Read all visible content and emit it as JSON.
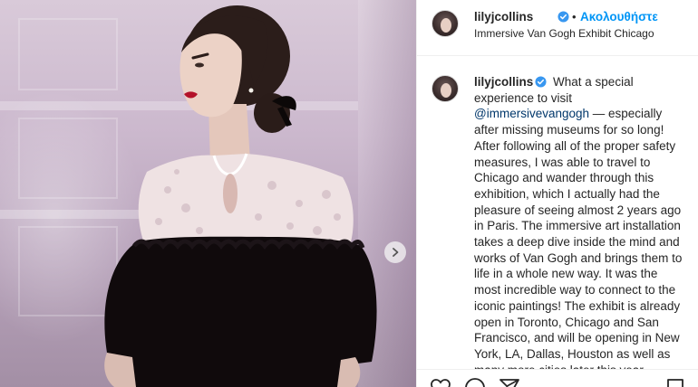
{
  "post": {
    "username": "lilyjcollins",
    "follow_separator": "•",
    "follow_label": "Ακολουθήστε",
    "location": "Immersive Van Gogh Exhibit Chicago",
    "caption_user": "lilyjcollins",
    "caption_text_1": " What a special experience to visit ",
    "caption_mention": "@immersivevangogh",
    "caption_text_2": " — especially after missing museums for so long! After following all of the proper safety measures, I was able to travel to Chicago and wander through this exhibition, which I actually had the pleasure of seeing almost 2 years ago in Paris. The immersive art installation takes a deep dive inside the mind and works of Van Gogh and brings them to life in a whole new way. It was the most incredible way to connect to the iconic paintings! The exhibit is already open in Toronto, Chicago and San Francisco, and will be opening in New York, LA, Dallas, Houston as well as many more cities later this year -"
  },
  "colors": {
    "link_blue": "#0095f6",
    "mention_blue": "#00376b",
    "verified_blue": "#3897f0",
    "text": "#262626",
    "border": "#efefef"
  },
  "icons": {
    "verified": "verified-badge-icon",
    "next": "chevron-right-icon",
    "like": "heart-icon",
    "comment": "comment-icon",
    "share": "paper-plane-icon",
    "save": "bookmark-icon"
  }
}
